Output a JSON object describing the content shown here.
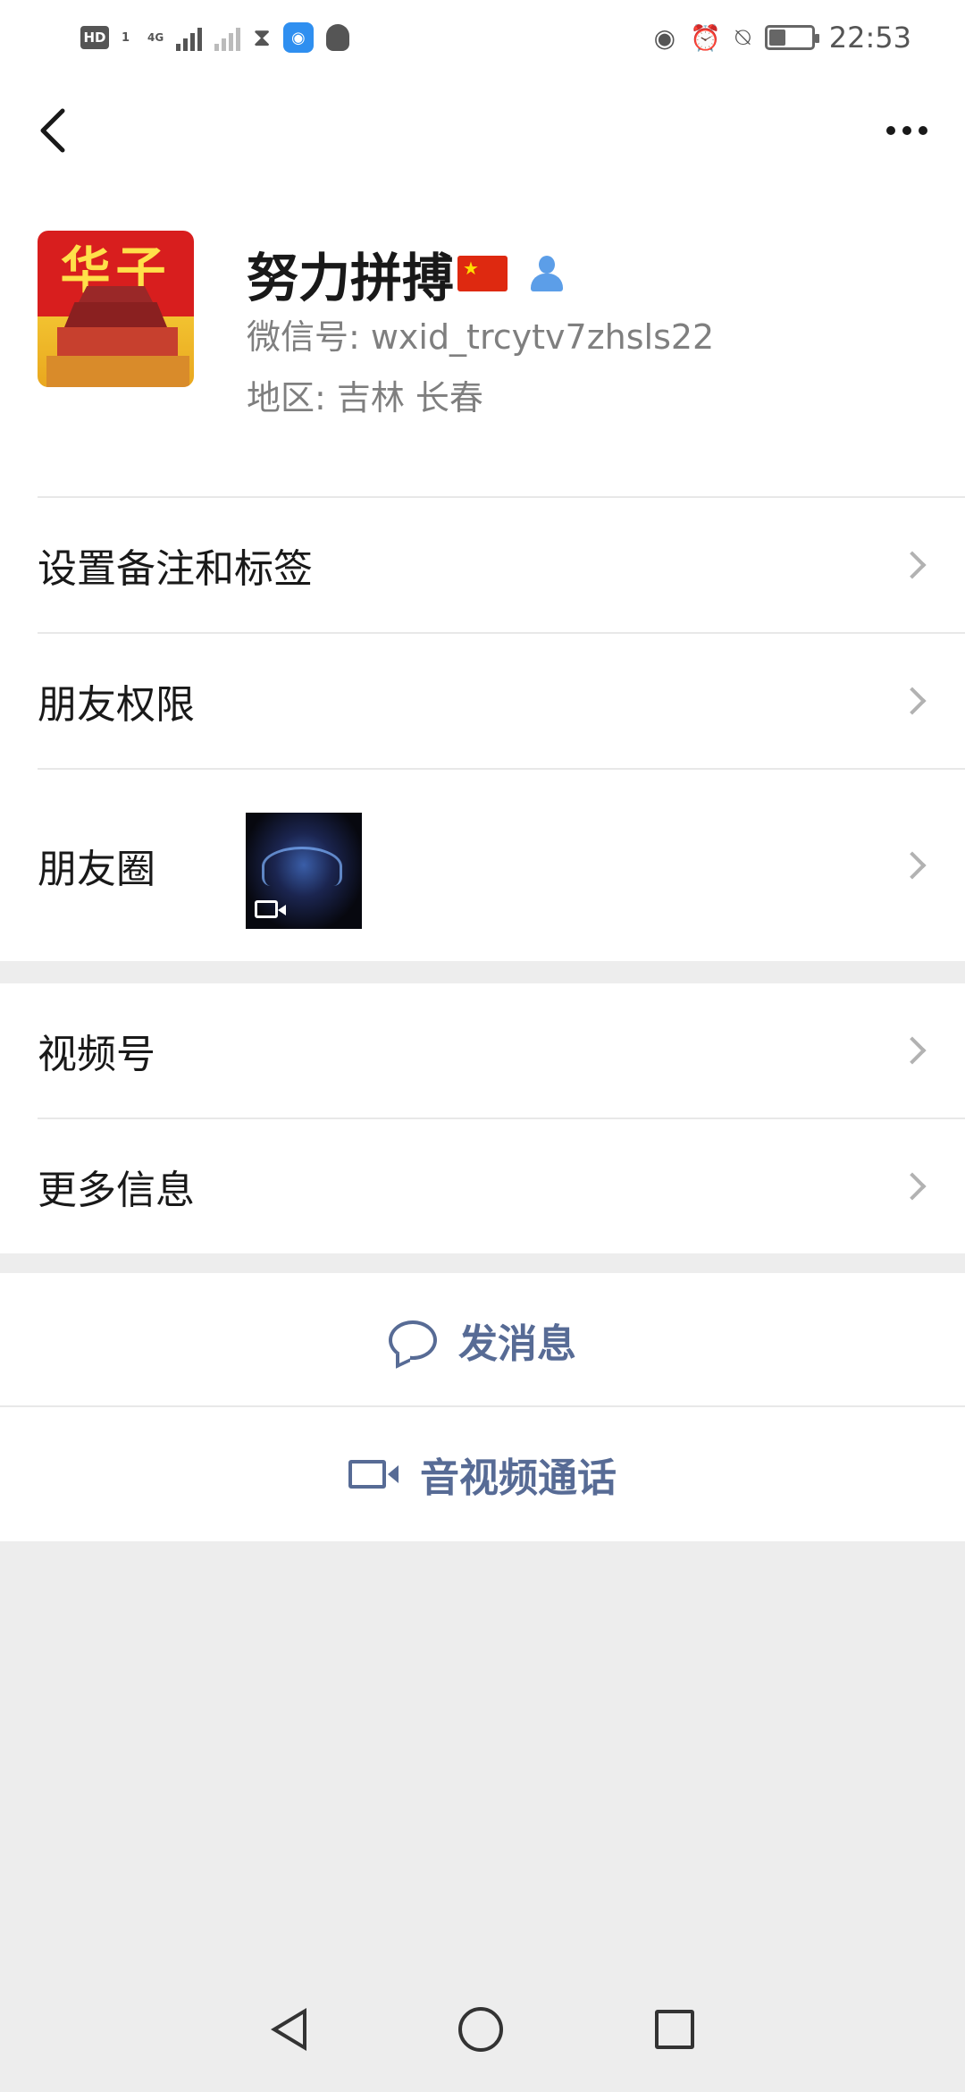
{
  "status_bar": {
    "hd": "HD",
    "sim": "1",
    "network": "4G",
    "time": "22:53",
    "icons": [
      "hd-icon",
      "signal-icon",
      "signal-faded-icon",
      "hourglass-icon",
      "wifi-hotspot-icon",
      "qq-icon",
      "eye-icon",
      "alarm-icon",
      "mute-icon",
      "battery-icon"
    ]
  },
  "nav": {
    "back_icon": "chevron-left-icon",
    "more_icon": "more-dots-icon"
  },
  "profile": {
    "avatar_text": "华子",
    "name": "努力拼搏",
    "wechat_id_label": "微信号:",
    "wechat_id": "wxid_trcytv7zhsls22",
    "region_label": "地区:",
    "region_province": "吉林",
    "region_city": "长春"
  },
  "menu_group1": [
    {
      "label": "设置备注和标签"
    },
    {
      "label": "朋友权限"
    },
    {
      "label": "朋友圈"
    }
  ],
  "menu_group2": [
    {
      "label": "视频号"
    },
    {
      "label": "更多信息"
    }
  ],
  "actions": {
    "message_label": "发消息",
    "call_label": "音视频通话"
  },
  "colors": {
    "link": "#576b95",
    "background": "#ededed",
    "avatar_red": "#d81e1e",
    "badge_blue": "#5c9ee8"
  }
}
